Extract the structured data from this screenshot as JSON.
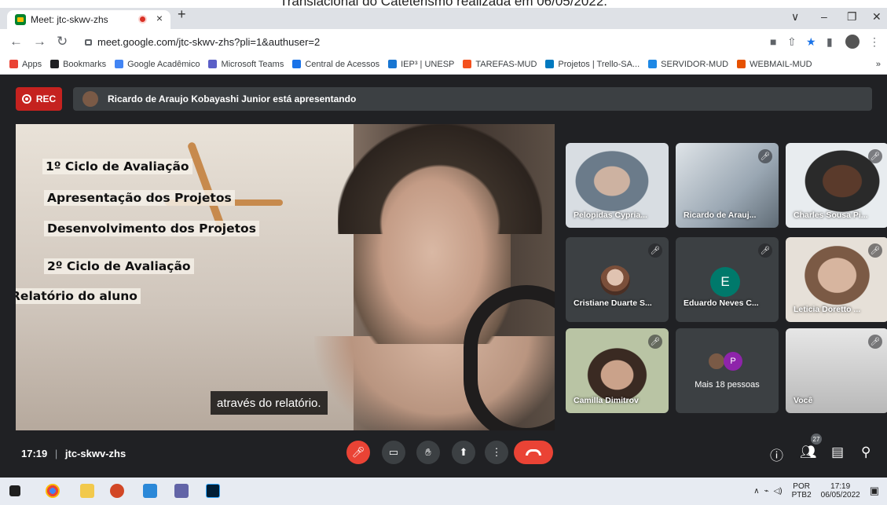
{
  "browser": {
    "tab_title": "Meet: jtc-skwv-zhs",
    "tab_close": "×",
    "new_tab": "+",
    "url": "meet.google.com/jtc-skwv-zhs?pli=1&authuser=2",
    "window_controls": [
      "∨",
      "–",
      "❐",
      "✕"
    ]
  },
  "bookmarks": [
    {
      "label": "Apps",
      "color": "#ea4335"
    },
    {
      "label": "Bookmarks",
      "color": "#202124"
    },
    {
      "label": "Google Acadêmico",
      "color": "#4285f4"
    },
    {
      "label": "Microsoft Teams",
      "color": "#5b5fc7"
    },
    {
      "label": "Central de Acessos",
      "color": "#1a73e8"
    },
    {
      "label": "IEP³ | UNESP",
      "color": "#1976d2"
    },
    {
      "label": "TAREFAS-MUD",
      "color": "#f4511e"
    },
    {
      "label": "Projetos | Trello-SA...",
      "color": "#0079bf"
    },
    {
      "label": "SERVIDOR-MUD",
      "color": "#1e88e5"
    },
    {
      "label": "WEBMAIL-MUD",
      "color": "#e65100"
    }
  ],
  "bookmarks_overflow": "»",
  "meet": {
    "rec_label": "REC",
    "presenting_text": "Ricardo de Araujo Kobayashi Junior está apresentando",
    "slide_lines": [
      "1º Ciclo de Avaliação",
      "Apresentação dos Projetos",
      "Desenvolvimento dos Projetos",
      "2º Ciclo de Avaliação",
      "Relatório do aluno"
    ],
    "subtitle": "através do relatório.",
    "participants": [
      {
        "name": "Pelopidas Cypria...",
        "kind": "video",
        "muted": false
      },
      {
        "name": "Ricardo de Arauj...",
        "kind": "video",
        "muted": true
      },
      {
        "name": "Charles Sousa Pi...",
        "kind": "video",
        "muted": true
      },
      {
        "name": "Cristiane Duarte S...",
        "kind": "avatar",
        "muted": true
      },
      {
        "name": "Eduardo Neves C...",
        "kind": "letter",
        "letter": "E",
        "muted": true
      },
      {
        "name": "Leticia Doretto ...",
        "kind": "video",
        "muted": true
      },
      {
        "name": "Camilla Dimitrov",
        "kind": "video",
        "muted": true
      },
      {
        "name": "Mais 18 pessoas",
        "kind": "more",
        "letter": "P",
        "muted": false
      },
      {
        "name": "Você",
        "kind": "video",
        "muted": true
      }
    ],
    "meeting_time": "17:19",
    "meeting_code": "jtc-skwv-zhs",
    "people_count": "27"
  },
  "taskbar": {
    "language_top": "POR",
    "language_bottom": "PTB2",
    "clock_time": "17:19",
    "clock_date": "06/05/2022"
  },
  "colors": {
    "meet_background": "#202124",
    "rec_red": "#c5221f",
    "control_red": "#ea4335",
    "tile_gray": "#3c4043"
  }
}
